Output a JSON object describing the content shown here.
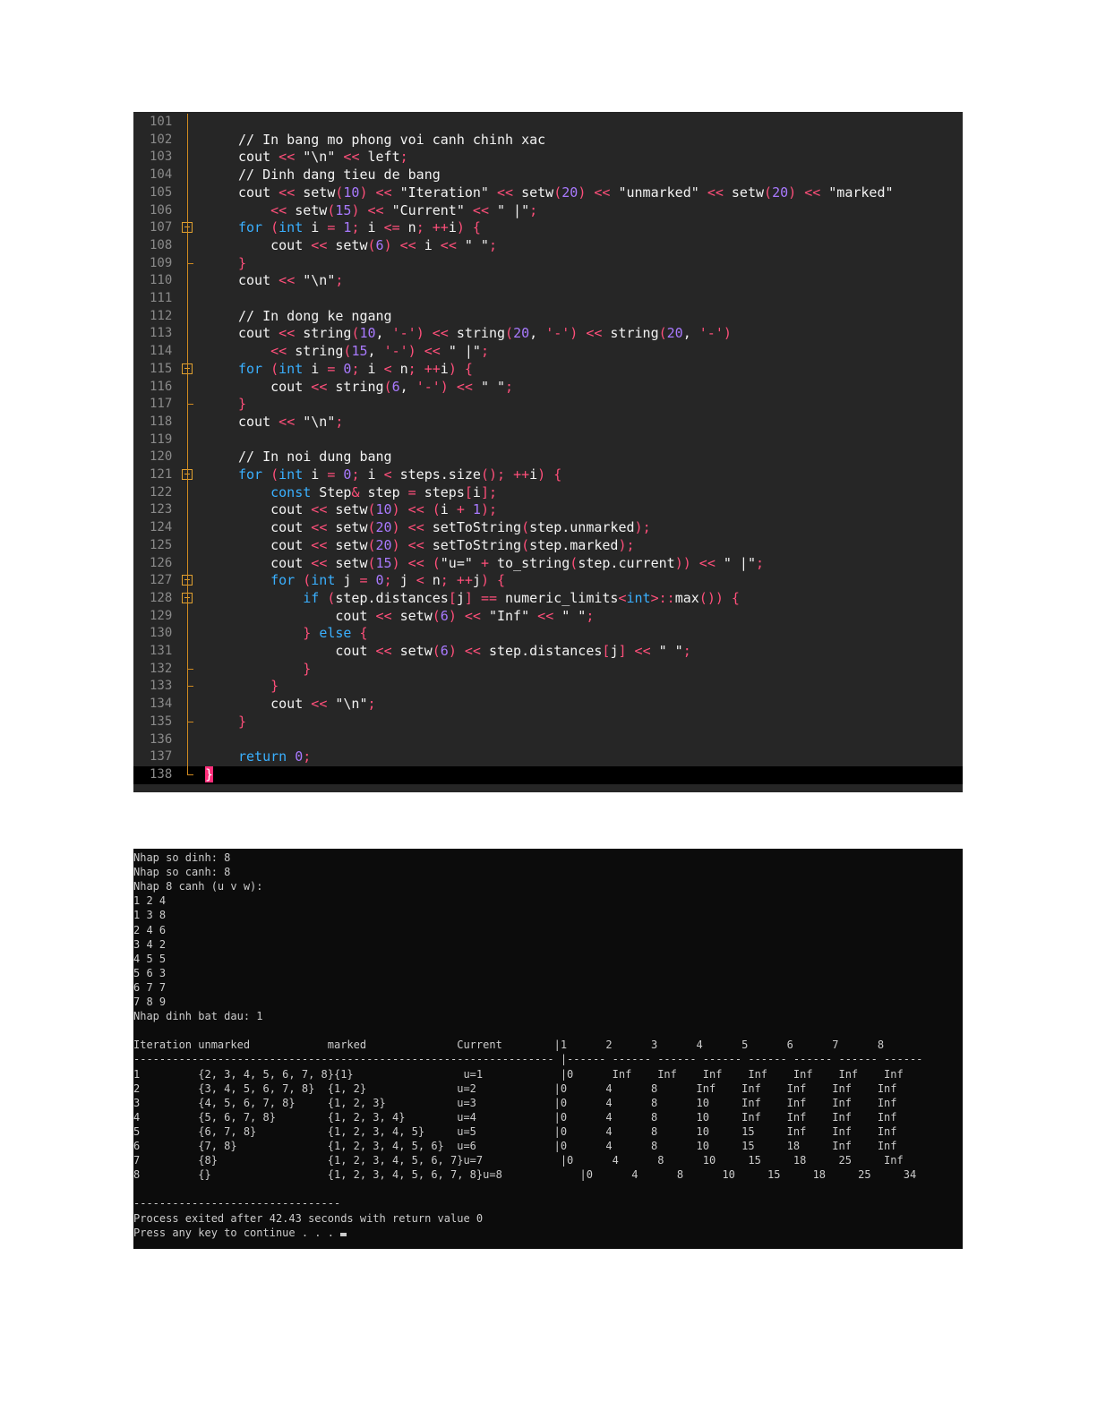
{
  "editor": {
    "lines": [
      {
        "n": "101",
        "code": ""
      },
      {
        "n": "102",
        "code": "// In bang mo phong voi canh chinh xac"
      },
      {
        "n": "103",
        "code": "cout << \"\\n\" << left;"
      },
      {
        "n": "104",
        "code": "// Dinh dang tieu de bang"
      },
      {
        "n": "105",
        "code": "cout << setw(10) << \"Iteration\" << setw(20) << \"unmarked\" << setw(20) << \"marked\""
      },
      {
        "n": "106",
        "code": "    << setw(15) << \"Current\" << \" |\";"
      },
      {
        "n": "107",
        "code": "for (int i = 1; i <= n; ++i) {"
      },
      {
        "n": "108",
        "code": "    cout << setw(6) << i << \" \";"
      },
      {
        "n": "109",
        "code": "}"
      },
      {
        "n": "110",
        "code": "cout << \"\\n\";"
      },
      {
        "n": "111",
        "code": ""
      },
      {
        "n": "112",
        "code": "// In dong ke ngang"
      },
      {
        "n": "113",
        "code": "cout << string(10, '-') << string(20, '-') << string(20, '-')"
      },
      {
        "n": "114",
        "code": "    << string(15, '-') << \" |\";"
      },
      {
        "n": "115",
        "code": "for (int i = 0; i < n; ++i) {"
      },
      {
        "n": "116",
        "code": "    cout << string(6, '-') << \" \";"
      },
      {
        "n": "117",
        "code": "}"
      },
      {
        "n": "118",
        "code": "cout << \"\\n\";"
      },
      {
        "n": "119",
        "code": ""
      },
      {
        "n": "120",
        "code": "// In noi dung bang"
      },
      {
        "n": "121",
        "code": "for (int i = 0; i < steps.size(); ++i) {"
      },
      {
        "n": "122",
        "code": "    const Step& step = steps[i];"
      },
      {
        "n": "123",
        "code": "    cout << setw(10) << (i + 1);"
      },
      {
        "n": "124",
        "code": "    cout << setw(20) << setToString(step.unmarked);"
      },
      {
        "n": "125",
        "code": "    cout << setw(20) << setToString(step.marked);"
      },
      {
        "n": "126",
        "code": "    cout << setw(15) << (\"u=\" + to_string(step.current)) << \" |\";"
      },
      {
        "n": "127",
        "code": "    for (int j = 0; j < n; ++j) {"
      },
      {
        "n": "128",
        "code": "        if (step.distances[j] == numeric_limits<int>::max()) {"
      },
      {
        "n": "129",
        "code": "            cout << setw(6) << \"Inf\" << \" \";"
      },
      {
        "n": "130",
        "code": "        } else {"
      },
      {
        "n": "131",
        "code": "            cout << setw(6) << step.distances[j] << \" \";"
      },
      {
        "n": "132",
        "code": "        }"
      },
      {
        "n": "133",
        "code": "    }"
      },
      {
        "n": "134",
        "code": "    cout << \"\\n\";"
      },
      {
        "n": "135",
        "code": "}"
      },
      {
        "n": "136",
        "code": ""
      },
      {
        "n": "137",
        "code": "return 0;"
      },
      {
        "n": "138",
        "code": "}"
      }
    ]
  },
  "console": {
    "lines": [
      "Nhap so dinh: 8",
      "Nhap so canh: 8",
      "Nhap 8 canh (u v w):",
      "1 2 4",
      "1 3 8",
      "2 4 6",
      "3 4 2",
      "4 5 5",
      "5 6 3",
      "6 7 7",
      "7 8 9",
      "Nhap dinh bat dau: 1",
      "",
      "Iteration unmarked            marked              Current        |1      2      3      4      5      6      7      8",
      "----------------------------------------------------------------- |------ ------ ------ ------ ------ ------ ------ ------",
      "1         {2, 3, 4, 5, 6, 7, 8}{1}                 u=1            |0      Inf    Inf    Inf    Inf    Inf    Inf    Inf",
      "2         {3, 4, 5, 6, 7, 8}  {1, 2}              u=2            |0      4      8      Inf    Inf    Inf    Inf    Inf",
      "3         {4, 5, 6, 7, 8}     {1, 2, 3}           u=3            |0      4      8      10     Inf    Inf    Inf    Inf",
      "4         {5, 6, 7, 8}        {1, 2, 3, 4}        u=4            |0      4      8      10     Inf    Inf    Inf    Inf",
      "5         {6, 7, 8}           {1, 2, 3, 4, 5}     u=5            |0      4      8      10     15     Inf    Inf    Inf",
      "6         {7, 8}              {1, 2, 3, 4, 5, 6}  u=6            |0      4      8      10     15     18     Inf    Inf",
      "7         {8}                 {1, 2, 3, 4, 5, 6, 7}u=7            |0      4      8      10     15     18     25     Inf",
      "8         {}                  {1, 2, 3, 4, 5, 6, 7, 8}u=8            |0      4      8      10     15     18     25     34",
      "",
      "--------------------------------",
      "Process exited after 42.43 seconds with return value 0",
      "Press any key to continue . . . "
    ]
  }
}
